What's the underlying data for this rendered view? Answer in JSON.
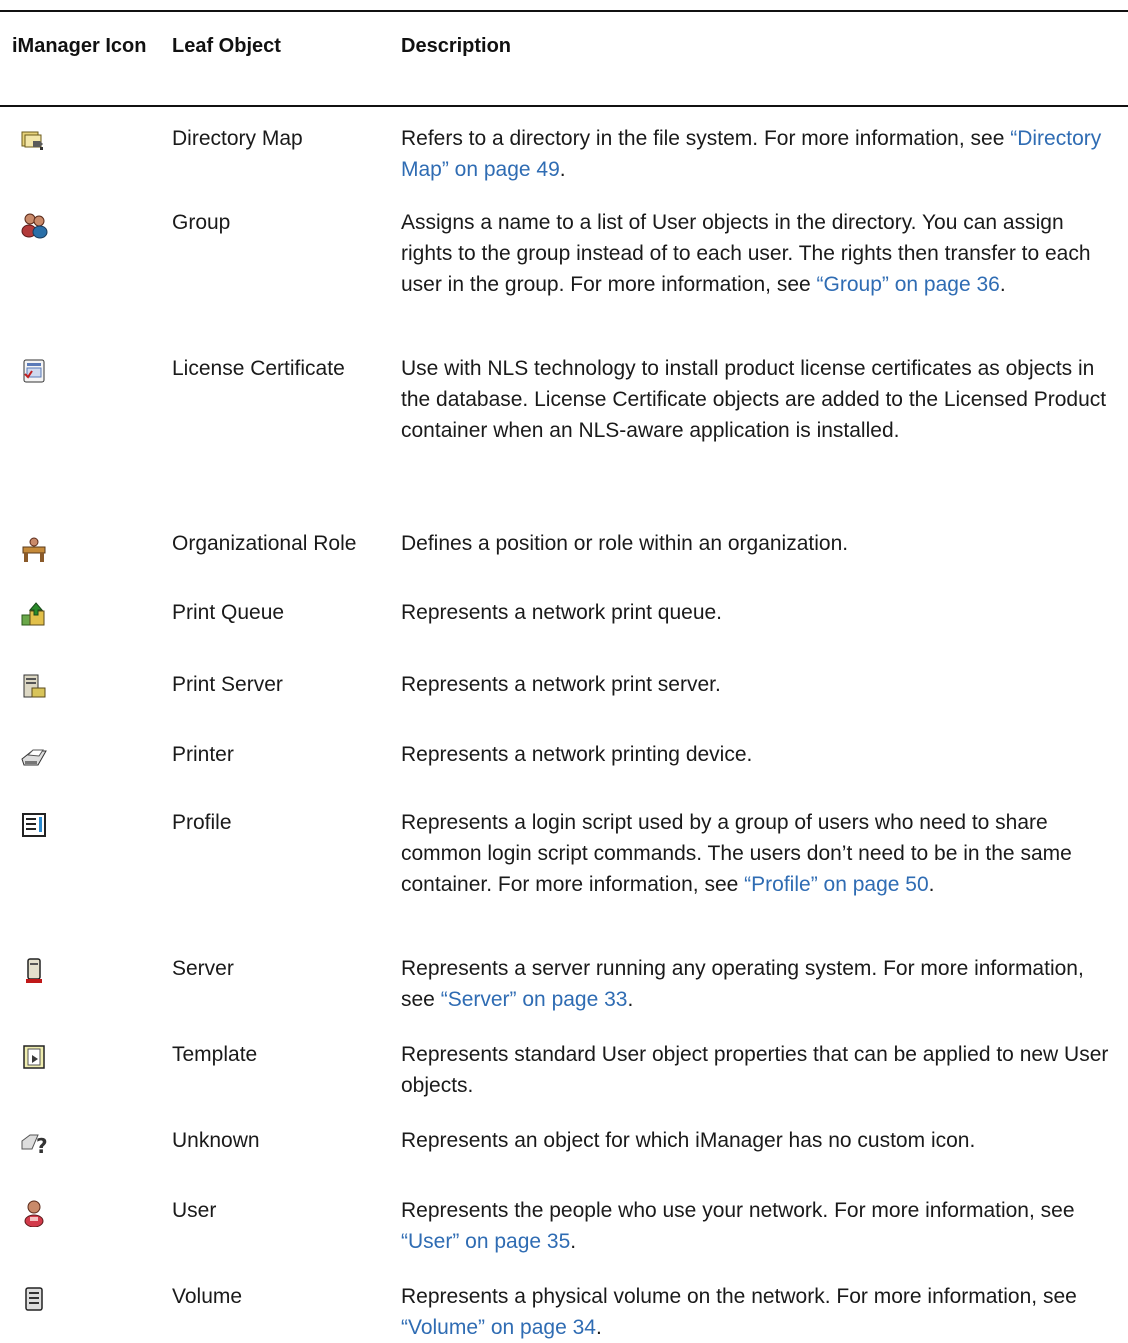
{
  "table": {
    "headers": {
      "icon": "iManager Icon",
      "leaf": "Leaf Object",
      "desc": "Description"
    },
    "rows": [
      {
        "icon": "directory-map-icon",
        "name": "Directory Map",
        "desc": "Refers to a directory in the file system. For more information, see ",
        "link": "“Directory Map” on page 49",
        "after": "."
      },
      {
        "icon": "group-icon",
        "name": "Group",
        "desc": "Assigns a name to a list of User objects in the directory. You can assign rights to the group instead of to each user. The rights then transfer to each user in the group. For more information, see ",
        "link": "“Group” on page 36",
        "after": "."
      },
      {
        "icon": "license-certificate-icon",
        "name": "License Certificate",
        "desc": "Use with NLS technology to install product license certificates as objects in the database. License Certificate objects are added to the Licensed Product container when an NLS-aware application is installed.",
        "link": "",
        "after": ""
      },
      {
        "icon": "organizational-role-icon",
        "name": "Organizational Role",
        "desc": "Defines a position or role within an organization.",
        "link": "",
        "after": ""
      },
      {
        "icon": "print-queue-icon",
        "name": "Print Queue",
        "desc": "Represents a network print queue.",
        "link": "",
        "after": ""
      },
      {
        "icon": "print-server-icon",
        "name": "Print Server",
        "desc": "Represents a network print server.",
        "link": "",
        "after": ""
      },
      {
        "icon": "printer-icon",
        "name": "Printer",
        "desc": "Represents a network printing device.",
        "link": "",
        "after": ""
      },
      {
        "icon": "profile-icon",
        "name": "Profile",
        "desc": "Represents a login script used by a group of users who need to share common login script commands. The users don’t need to be in the same container. For more information, see ",
        "link": "“Profile” on page 50",
        "after": "."
      },
      {
        "icon": "server-icon",
        "name": "Server",
        "desc": "Represents a server running any operating system. For more information, see ",
        "link": "“Server” on page 33",
        "after": "."
      },
      {
        "icon": "template-icon",
        "name": "Template",
        "desc": "Represents standard User object properties that can be applied to new User objects.",
        "link": "",
        "after": ""
      },
      {
        "icon": "unknown-icon",
        "name": "Unknown",
        "desc": "Represents an object for which iManager has no custom icon.",
        "link": "",
        "after": ""
      },
      {
        "icon": "user-icon",
        "name": "User",
        "desc": "Represents the people who use your network. For more information, see ",
        "link": "“User” on page 35",
        "after": "."
      },
      {
        "icon": "volume-icon",
        "name": "Volume",
        "desc": "Represents a physical volume on the network. For more information, see ",
        "link": "“Volume” on page 34",
        "after": "."
      }
    ]
  },
  "colors": {
    "link": "#2f6cb3",
    "rule": "#111111"
  }
}
